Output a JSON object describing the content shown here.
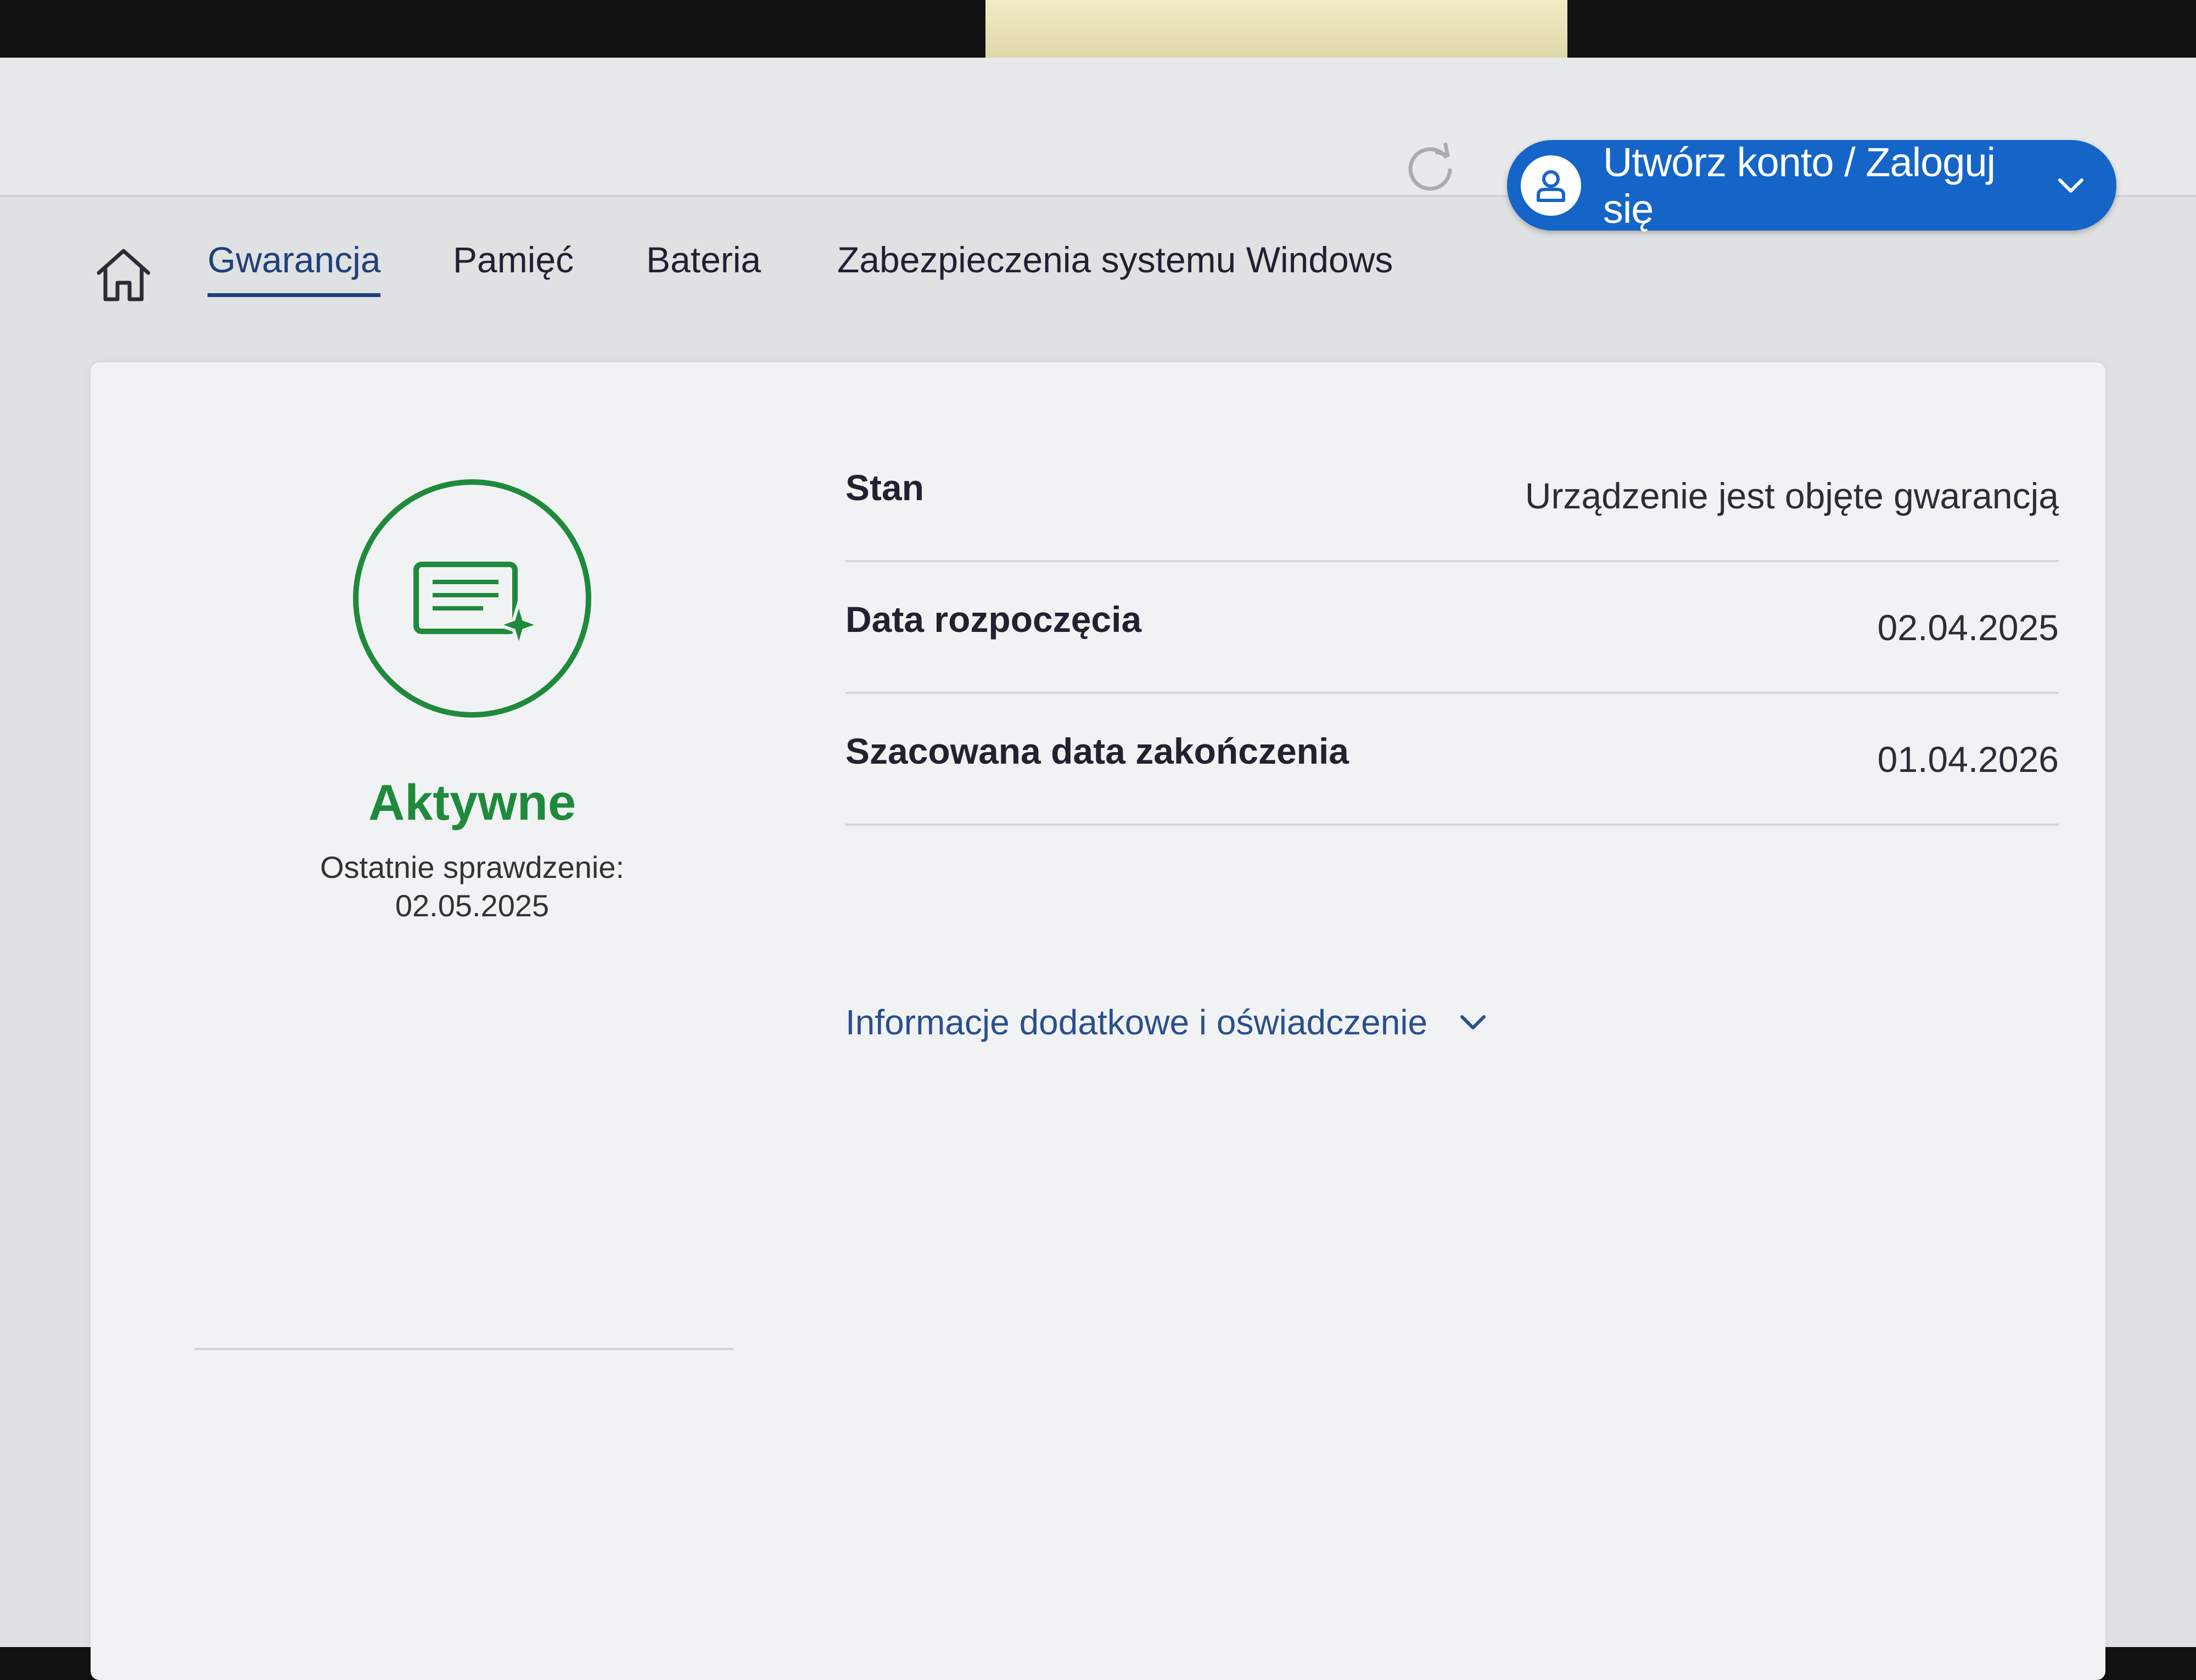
{
  "header": {
    "account_button_label": "Utwórz konto / Zaloguj się",
    "accent_color": "#1565c8"
  },
  "nav": {
    "tabs": [
      {
        "label": "Gwarancja",
        "active": true
      },
      {
        "label": "Pamięć",
        "active": false
      },
      {
        "label": "Bateria",
        "active": false
      },
      {
        "label": "Zabezpieczenia systemu Windows",
        "active": false
      }
    ]
  },
  "warranty": {
    "status_title": "Aktywne",
    "last_check_label": "Ostatnie sprawdzenie:",
    "last_check_date": "02.05.2025",
    "status_color": "#1f8a3c",
    "details": [
      {
        "label": "Stan",
        "value": "Urządzenie jest objęte gwarancją"
      },
      {
        "label": "Data rozpoczęcia",
        "value": "02.04.2025"
      },
      {
        "label": "Szacowana data zakończenia",
        "value": "01.04.2026"
      }
    ],
    "more_info_label": "Informacje dodatkowe i oświadczenie"
  },
  "icons": [
    "refresh-icon",
    "user-icon",
    "chevron-down-icon",
    "home-icon",
    "certificate-icon"
  ]
}
